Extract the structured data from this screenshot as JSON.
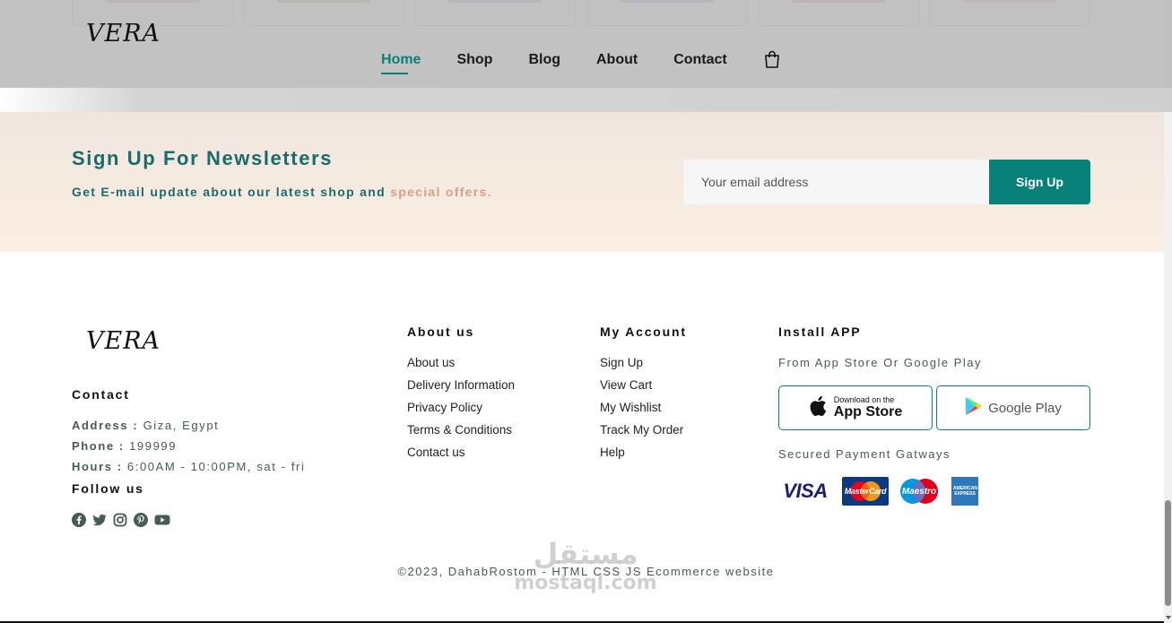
{
  "header": {
    "logo": "VERA",
    "nav": [
      {
        "label": "Home",
        "active": true
      },
      {
        "label": "Shop",
        "active": false
      },
      {
        "label": "Blog",
        "active": false
      },
      {
        "label": "About",
        "active": false
      },
      {
        "label": "Contact",
        "active": false
      }
    ],
    "cart_icon": "bag-icon"
  },
  "product_cards": {
    "strip_colors": [
      "#e4b3b0",
      "#a7cf9d",
      "#a9bde0",
      "#a9bde0",
      "#e2a8b8",
      "#f0c8c6"
    ]
  },
  "newsletter": {
    "title": "Sign Up For Newsletters",
    "subtitle_prefix": "Get E-mail update about our latest shop and ",
    "subtitle_accent": "special offers.",
    "email_placeholder": "Your email address",
    "button_label": "Sign Up"
  },
  "footer": {
    "logo": "VERA",
    "contact_heading": "Contact",
    "address_label": "Address :",
    "address_value": " Giza, Egypt",
    "phone_label": "Phone :",
    "phone_value": " 199999",
    "hours_label": "Hours :",
    "hours_value": " 6:00AM - 10:00PM, sat - fri",
    "follow_heading": "Follow us",
    "social_icons": [
      "facebook-icon",
      "twitter-icon",
      "instagram-icon",
      "pinterest-icon",
      "youtube-icon"
    ],
    "about_heading": "About us",
    "about_links": [
      "About us",
      "Delivery Information",
      "Privacy Policy",
      "Terms & Conditions",
      "Contact us"
    ],
    "account_heading": "My Account",
    "account_links": [
      "Sign Up",
      "View Cart",
      "My Wishlist",
      "Track My Order",
      "Help"
    ],
    "install_heading": "Install APP",
    "install_sub": "From App Store Or Google Play",
    "app_store_small": "Download on the",
    "app_store_big": "App Store",
    "google_play_label": "Google Play",
    "payment_heading": "Secured Payment Gatways",
    "payment_methods": [
      "VISA",
      "MasterCard",
      "Maestro",
      "AMERICAN EXPRESS"
    ],
    "copyright": "©2023, DahabRostom - HTML CSS JS Ecommerce website"
  },
  "watermark": {
    "arabic": "مستقل",
    "latin": "mostaql.com"
  },
  "colors": {
    "primary": "#088178",
    "heading_teal": "#1a6b6b",
    "accent": "#d7a08a",
    "text_muted": "#465b52"
  }
}
